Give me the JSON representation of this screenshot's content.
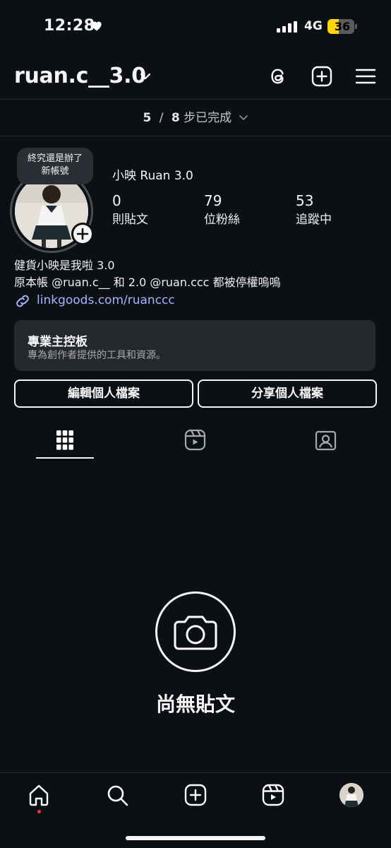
{
  "status_bar": {
    "time": "12:28",
    "network": "4G",
    "battery": "36"
  },
  "header": {
    "username": "ruan.c__3.0"
  },
  "progress": {
    "done": "5",
    "sep": "/",
    "total": "8",
    "label": "步已完成"
  },
  "profile": {
    "note_bubble": "終究還是辦了\n新帳號",
    "display_name": "小映 Ruan 3.0",
    "stats": [
      {
        "value": "0",
        "label": "則貼文"
      },
      {
        "value": "79",
        "label": "位粉絲"
      },
      {
        "value": "53",
        "label": "追蹤中"
      }
    ],
    "bio_lines": [
      "健貨小映是我啦 3.0",
      "原本帳 @ruan.c__ 和 2.0 @ruan.ccc 都被停權嗚嗚"
    ],
    "link": "linkgoods.com/ruanccc"
  },
  "dashboard": {
    "title": "專業主控板",
    "subtitle": "專為創作者提供的工具和資源。"
  },
  "buttons": {
    "edit": "編輯個人檔案",
    "share": "分享個人檔案"
  },
  "empty_state": {
    "label": "尚無貼文"
  },
  "icons": {
    "header": [
      "threads-icon",
      "new-post-icon",
      "menu-icon"
    ],
    "tabs": [
      "grid-icon",
      "reels-icon",
      "tagged-icon"
    ],
    "nav": [
      "home-icon",
      "search-icon",
      "create-icon",
      "reels-icon",
      "profile-avatar"
    ]
  },
  "colors": {
    "background": "#0c1014",
    "link": "#a6b5ff",
    "card": "#25292e",
    "notification": "#ff3040",
    "battery": "#ffd60a"
  }
}
